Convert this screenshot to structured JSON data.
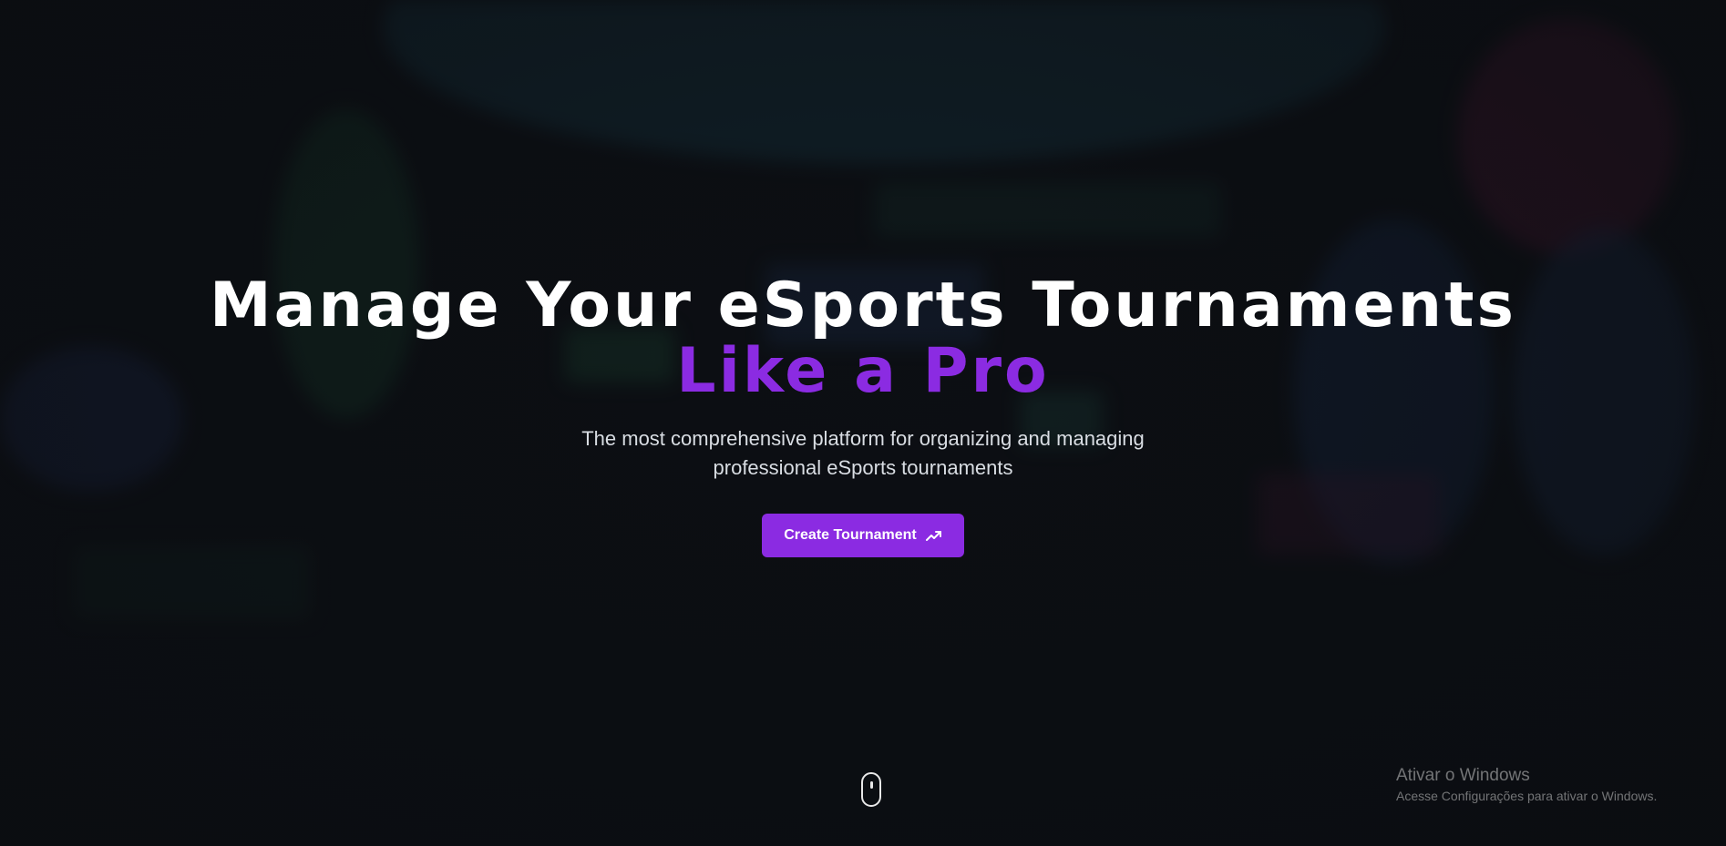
{
  "hero": {
    "headline": "Manage Your eSports Tournaments",
    "headline_accent": "Like a Pro",
    "subtitle": "The most comprehensive platform for organizing and managing professional eSports tournaments",
    "cta_label": "Create Tournament",
    "cta_icon": "trending-up-icon",
    "scroll_icon": "mouse-scroll-icon"
  },
  "watermark": {
    "title": "Ativar o Windows",
    "subtitle": "Acesse Configurações para ativar o Windows."
  },
  "colors": {
    "accent": "#8b2be2",
    "background": "#0e1217",
    "headline": "#ffffff",
    "subtitle": "#d9dde3"
  }
}
